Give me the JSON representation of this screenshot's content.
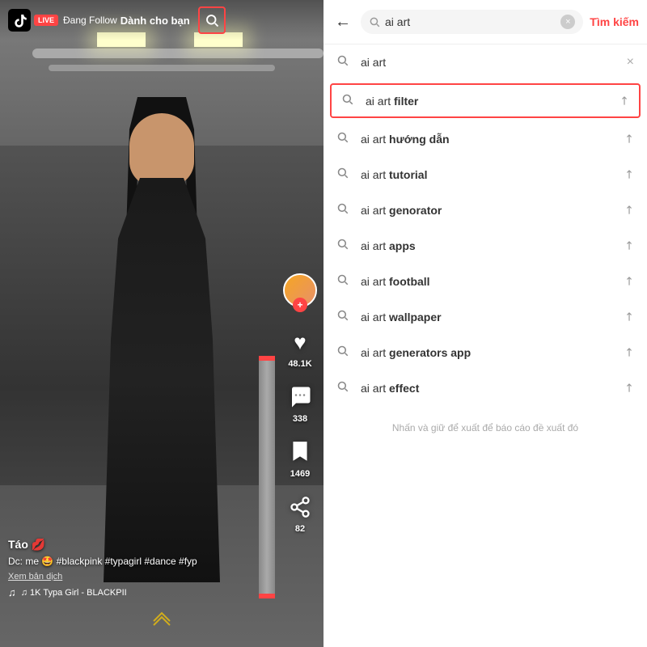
{
  "left": {
    "header": {
      "live_badge": "LIVE",
      "dang_follow": "Đang Follow",
      "danh_cho_ban": "Dành cho bạn"
    },
    "user": {
      "username": "Táo 💋",
      "description": "Dc: me 🤩 #blackpink #typagirl #dance\n#fyp",
      "xem_ban_dich": "Xem bản dịch",
      "music": "♫ 1K   Typa Girl - BLACKPII"
    },
    "actions": [
      {
        "icon": "♥",
        "count": "48.1K"
      },
      {
        "icon": "💬",
        "count": "338"
      },
      {
        "icon": "🔖",
        "count": "1469"
      },
      {
        "icon": "↗",
        "count": "82"
      }
    ]
  },
  "right": {
    "search_value": "ai art",
    "clear_btn_label": "×",
    "tim_kiem": "Tìm kiếm",
    "results": [
      {
        "id": "ai-art",
        "text_main": "ai art",
        "text_bold": "",
        "highlighted": false
      },
      {
        "id": "ai-art-filter",
        "text_main": "ai art ",
        "text_bold": "filter",
        "highlighted": true
      },
      {
        "id": "ai-art-huong-dan",
        "text_main": "ai art ",
        "text_bold": "hướng dẫn",
        "highlighted": false
      },
      {
        "id": "ai-art-tutorial",
        "text_main": "ai art ",
        "text_bold": "tutorial",
        "highlighted": false
      },
      {
        "id": "ai-art-genorator",
        "text_main": "ai art ",
        "text_bold": "genorator",
        "highlighted": false
      },
      {
        "id": "ai-art-apps",
        "text_main": "ai art ",
        "text_bold": "apps",
        "highlighted": false
      },
      {
        "id": "ai-art-football",
        "text_main": "ai art ",
        "text_bold": "football",
        "highlighted": false
      },
      {
        "id": "ai-art-wallpaper",
        "text_main": "ai art ",
        "text_bold": "wallpaper",
        "highlighted": false
      },
      {
        "id": "ai-art-generators-app",
        "text_main": "ai art ",
        "text_bold": "generators app",
        "highlighted": false
      },
      {
        "id": "ai-art-effect",
        "text_main": "ai art ",
        "text_bold": "effect",
        "highlighted": false
      }
    ],
    "footer_note": "Nhấn và giữ để xuất để báo cáo đề xuất đó"
  }
}
